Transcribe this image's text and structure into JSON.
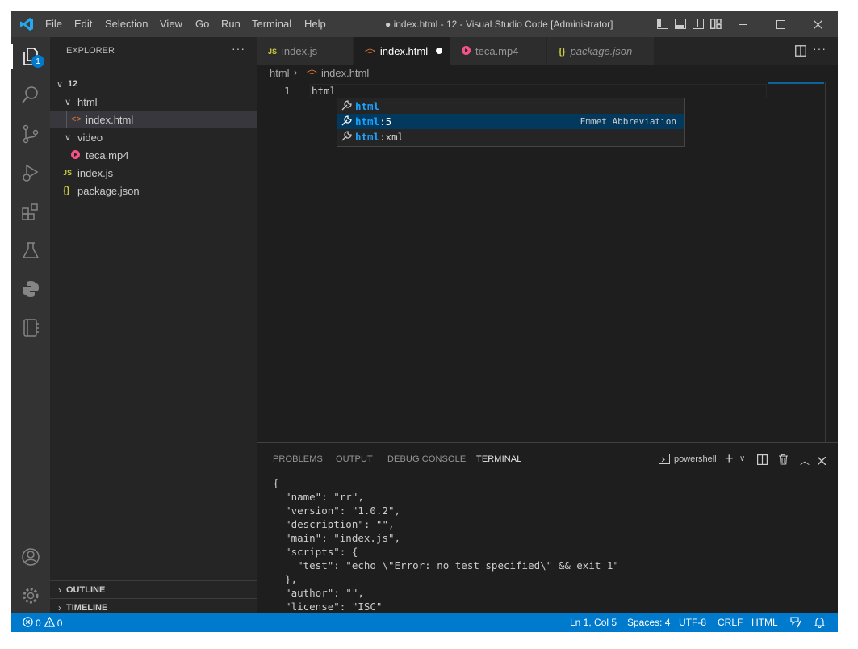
{
  "titlebar": {
    "menu": [
      "File",
      "Edit",
      "Selection",
      "View",
      "Go",
      "Run",
      "Terminal",
      "Help"
    ],
    "title": "● index.html - 12 - Visual Studio Code [Administrator]"
  },
  "activitybar": {
    "explorer_badge": "1"
  },
  "sidebar": {
    "header": "EXPLORER",
    "more": "···",
    "root": "12",
    "tree": {
      "html_folder": "html",
      "index_html": "index.html",
      "video_folder": "video",
      "teca_mp4": "teca.mp4",
      "index_js": "index.js",
      "package_json": "package.json"
    },
    "outline": "OUTLINE",
    "timeline": "TIMELINE"
  },
  "tabs": [
    {
      "icon": "JS",
      "label": "index.js",
      "active": false
    },
    {
      "icon": "<>",
      "label": "index.html",
      "active": true,
      "dirty": true
    },
    {
      "icon": "▶",
      "label": "teca.mp4",
      "active": false
    },
    {
      "icon": "{}",
      "label": "package.json",
      "active": false
    }
  ],
  "breadcrumb": {
    "folder": "html",
    "file": "index.html"
  },
  "editor": {
    "line_number": "1",
    "line_text": "html"
  },
  "suggest": {
    "items": [
      {
        "match": "html",
        "rest": "",
        "detail": ""
      },
      {
        "match": "html",
        "rest": ":5",
        "detail": "Emmet Abbreviation"
      },
      {
        "match": "html",
        "rest": ":xml",
        "detail": ""
      }
    ]
  },
  "panel": {
    "tabs": [
      "PROBLEMS",
      "OUTPUT",
      "DEBUG CONSOLE",
      "TERMINAL"
    ],
    "active_tab": "TERMINAL",
    "shell": "powershell",
    "terminal_lines": [
      "{",
      "  \"name\": \"rr\",",
      "  \"version\": \"1.0.2\",",
      "  \"description\": \"\",",
      "  \"main\": \"index.js\",",
      "  \"scripts\": {",
      "    \"test\": \"echo \\\"Error: no test specified\\\" && exit 1\"",
      "  },",
      "  \"author\": \"\",",
      "  \"license\": \"ISC\""
    ]
  },
  "statusbar": {
    "errors": "0",
    "warnings": "0",
    "position": "Ln 1, Col 5",
    "spaces": "Spaces: 4",
    "encoding": "UTF-8",
    "eol": "CRLF",
    "language": "HTML"
  },
  "colors": {
    "accent": "#007acc",
    "titlebar": "#3c3c3c",
    "activitybar": "#333333",
    "sidebar": "#252526",
    "editor": "#1e1e1e",
    "html_icon": "#e37933",
    "js_icon": "#cbcb41",
    "json_icon": "#cbcb41",
    "video_icon": "#f55385",
    "suggest_match": "#18a3ff"
  }
}
